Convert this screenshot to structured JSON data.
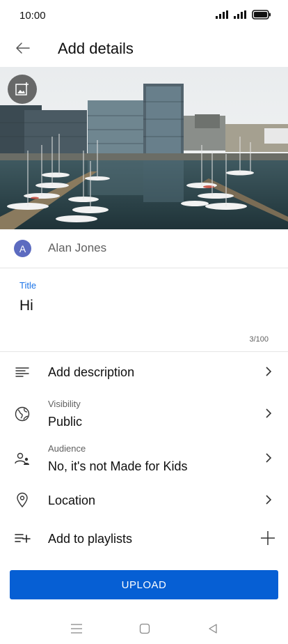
{
  "status_bar": {
    "time": "10:00"
  },
  "app_bar": {
    "title": "Add details"
  },
  "account": {
    "avatar_letter": "A",
    "name": "Alan Jones"
  },
  "title_field": {
    "label": "Title",
    "value": "Hi",
    "char_count": "3/100"
  },
  "rows": {
    "description": {
      "label": "Add description"
    },
    "visibility": {
      "caption": "Visibility",
      "value": "Public"
    },
    "audience": {
      "caption": "Audience",
      "value": "No, it's not Made for Kids"
    },
    "location": {
      "label": "Location"
    },
    "playlists": {
      "label": "Add to playlists"
    }
  },
  "upload": {
    "label": "UPLOAD"
  },
  "colors": {
    "accent": "#065fd4",
    "label_blue": "#1a73e8",
    "avatar": "#5c6bc0"
  }
}
